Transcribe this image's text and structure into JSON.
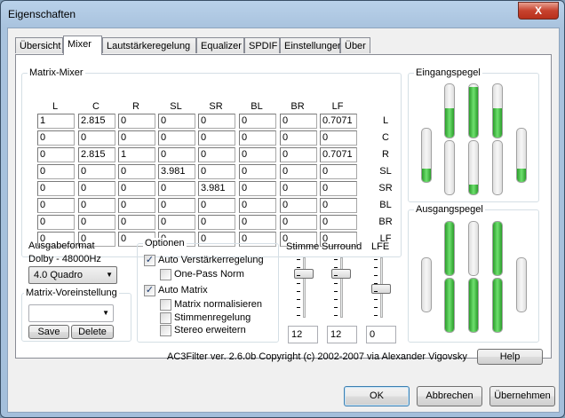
{
  "window": {
    "title": "Eigenschaften",
    "close": "X"
  },
  "tabs": [
    "Übersicht",
    "Mixer",
    "Lautstärkeregelung",
    "Equalizer",
    "SPDIF",
    "Einstellungen",
    "Über"
  ],
  "active_tab": "Mixer",
  "matrix": {
    "label": "Matrix-Mixer",
    "columns": [
      "L",
      "C",
      "R",
      "SL",
      "SR",
      "BL",
      "BR",
      "LF"
    ],
    "rows": [
      {
        "label": "L",
        "values": [
          "1",
          "2.815",
          "0",
          "0",
          "0",
          "0",
          "0",
          "0.7071"
        ]
      },
      {
        "label": "C",
        "values": [
          "0",
          "0",
          "0",
          "0",
          "0",
          "0",
          "0",
          "0"
        ]
      },
      {
        "label": "R",
        "values": [
          "0",
          "2.815",
          "1",
          "0",
          "0",
          "0",
          "0",
          "0.7071"
        ]
      },
      {
        "label": "SL",
        "values": [
          "0",
          "0",
          "0",
          "3.981",
          "0",
          "0",
          "0",
          "0"
        ]
      },
      {
        "label": "SR",
        "values": [
          "0",
          "0",
          "0",
          "0",
          "3.981",
          "0",
          "0",
          "0"
        ]
      },
      {
        "label": "BL",
        "values": [
          "0",
          "0",
          "0",
          "0",
          "0",
          "0",
          "0",
          "0"
        ]
      },
      {
        "label": "BR",
        "values": [
          "0",
          "0",
          "0",
          "0",
          "0",
          "0",
          "0",
          "0"
        ]
      },
      {
        "label": "LF",
        "values": [
          "0",
          "0",
          "0",
          "0",
          "0",
          "0",
          "0",
          "0"
        ]
      }
    ]
  },
  "input_level": {
    "label": "Eingangspegel",
    "top_levels": [
      0.55,
      0.0,
      0.95,
      0.0
    ],
    "bottom_levels": [
      0.0,
      0.0,
      0.18,
      0.0
    ],
    "side_levels": [
      0.25,
      0.35
    ]
  },
  "output_level": {
    "label": "Ausgangspegel",
    "top_levels": [
      0.0,
      1.0,
      0.0,
      1.0
    ],
    "bottom_levels": [
      1.0,
      1.0,
      1.0,
      0.0
    ],
    "side_levels": [
      0.0,
      0.0
    ]
  },
  "output_format": {
    "label": "Ausgabeformat",
    "value": "Dolby - 48000Hz",
    "selected": "4.0 Quadro"
  },
  "matrix_preset": {
    "label": "Matrix-Voreinstellung",
    "selected": "",
    "save": "Save",
    "delete": "Delete"
  },
  "options": {
    "label": "Optionen",
    "auto_gain": {
      "label": "Auto Verstärkerregelung",
      "checked": true
    },
    "one_pass": {
      "label": "One-Pass Norm",
      "checked": false
    },
    "auto_matrix": {
      "label": "Auto Matrix",
      "checked": true
    },
    "normalize": {
      "label": "Matrix normalisieren",
      "checked": false
    },
    "voice_control": {
      "label": "Stimmenregelung",
      "checked": false
    },
    "stereo_expand": {
      "label": "Stereo erweitern",
      "checked": false
    }
  },
  "sliders": {
    "voice": {
      "label": "Stimme",
      "value": "12"
    },
    "surround": {
      "label": "Surround",
      "value": "12"
    },
    "lfe": {
      "label": "LFE",
      "value": "0"
    }
  },
  "copyright": "AC3Filter ver. 2.6.0b Copyright (c) 2002-2007 via Alexander Vigovsky",
  "help": "Help",
  "buttons": {
    "ok": "OK",
    "cancel": "Abbrechen",
    "apply": "Übernehmen"
  }
}
